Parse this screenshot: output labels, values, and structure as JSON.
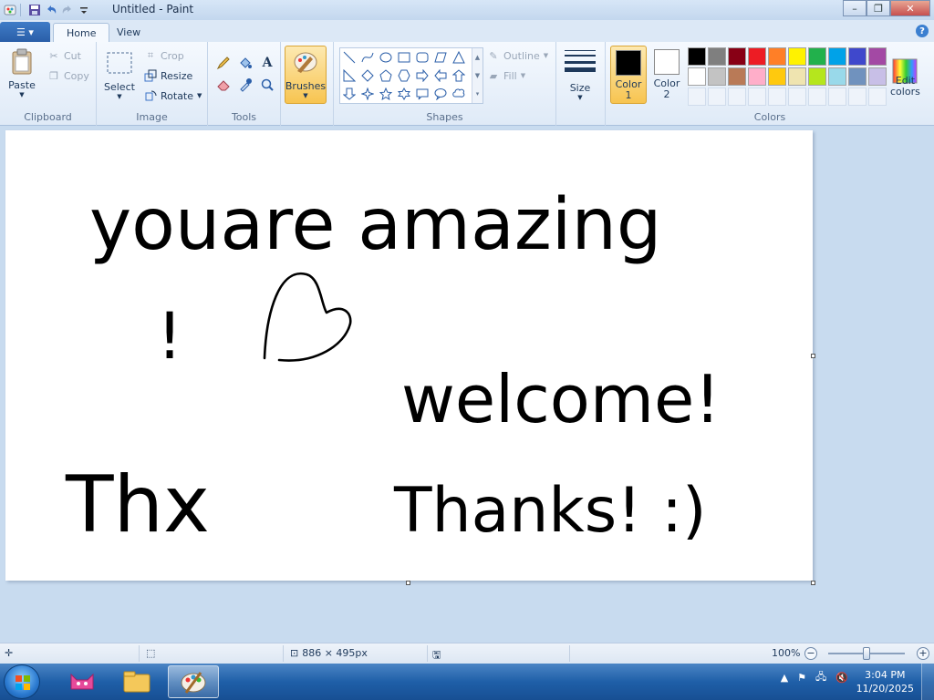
{
  "window": {
    "title": "Untitled - Paint",
    "minimize": "–",
    "maximize": "❐",
    "close": "✕"
  },
  "tabs": {
    "file": "☰ ▾",
    "home": "Home",
    "view": "View",
    "help": "?"
  },
  "clipboard": {
    "paste": "Paste",
    "cut": "Cut",
    "copy": "Copy",
    "label": "Clipboard"
  },
  "image": {
    "select": "Select",
    "crop": "Crop",
    "resize": "Resize",
    "rotate": "Rotate",
    "label": "Image"
  },
  "tools": {
    "label": "Tools",
    "text": "A"
  },
  "brushes": {
    "label": "Brushes"
  },
  "shapes": {
    "outline": "Outline",
    "fill": "Fill",
    "label": "Shapes"
  },
  "size": {
    "label": "Size"
  },
  "colors": {
    "color1_label": "Color\n1",
    "color1_value": "#000000",
    "color2_label": "Color\n2",
    "color2_value": "#ffffff",
    "edit_label": "Edit\ncolors",
    "label": "Colors",
    "palette_row1": [
      "#000000",
      "#7f7f7f",
      "#880015",
      "#ed1c24",
      "#ff7f27",
      "#fff200",
      "#22b14c",
      "#00a2e8",
      "#3f48cc",
      "#a349a4"
    ],
    "palette_row2": [
      "#ffffff",
      "#c3c3c3",
      "#b97a57",
      "#ffaec9",
      "#ffc90e",
      "#efe4b0",
      "#b5e61d",
      "#99d9ea",
      "#7092be",
      "#c8bfe7"
    ]
  },
  "canvas_text": {
    "line1": "youare amazing",
    "line2": "!",
    "line3": "welcome!",
    "line4": "Thx",
    "line5": "Thanks! :)"
  },
  "status": {
    "dimensions": "886 × 495px",
    "zoom": "100%",
    "zoom_out": "−",
    "zoom_in": "+"
  },
  "taskbar": {
    "time": "3:04 PM",
    "date": "11/20/2025"
  }
}
